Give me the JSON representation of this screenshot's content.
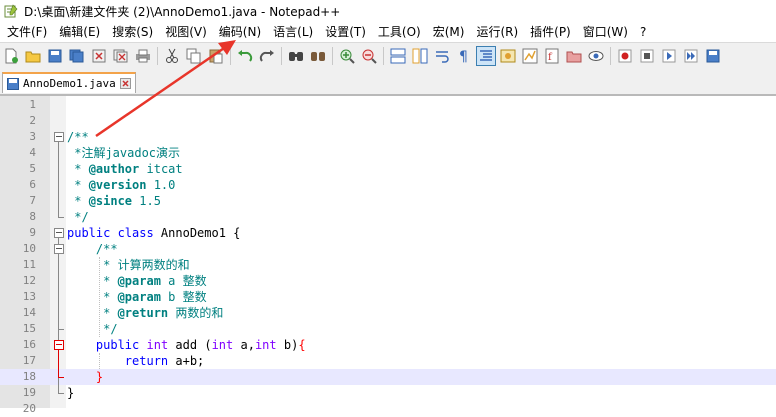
{
  "window": {
    "title": "D:\\桌面\\新建文件夹 (2)\\AnnoDemo1.java - Notepad++"
  },
  "menu": [
    "文件(F)",
    "编辑(E)",
    "搜索(S)",
    "视图(V)",
    "编码(N)",
    "语言(L)",
    "设置(T)",
    "工具(O)",
    "宏(M)",
    "运行(R)",
    "插件(P)",
    "窗口(W)",
    "?"
  ],
  "tab": {
    "label": "AnnoDemo1.java"
  },
  "editor": {
    "current_line": 18,
    "lines": [
      {
        "n": "1",
        "text": ""
      },
      {
        "n": "2",
        "text": ""
      },
      {
        "n": "3",
        "text": "/**"
      },
      {
        "n": "4",
        "text": " *注解javadoc演示"
      },
      {
        "n": "5",
        "at": "@author",
        "rest": " itcat"
      },
      {
        "n": "6",
        "at": "@version",
        "rest": " 1.0"
      },
      {
        "n": "7",
        "at": "@since",
        "rest": " 1.5"
      },
      {
        "n": "8",
        "text": " */"
      },
      {
        "n": "9",
        "kw": "public class",
        "rest": " AnnoDemo1 {"
      },
      {
        "n": "10",
        "text": "    /**"
      },
      {
        "n": "11",
        "text": "     * 计算两数的和"
      },
      {
        "n": "12",
        "at": "@param",
        "rest": " a 整数"
      },
      {
        "n": "13",
        "at": "@param",
        "rest": " b 整数"
      },
      {
        "n": "14",
        "at": "@return",
        "rest": " 两数的和"
      },
      {
        "n": "15",
        "text": "     */"
      },
      {
        "n": "16",
        "kw1": "public",
        "type1": "int",
        "name": "add",
        "type2": "int",
        "p1": "a,",
        "type3": "int",
        "p2": "b)",
        "brace": "{"
      },
      {
        "n": "17",
        "kw": "return",
        "rest": " a+b;"
      },
      {
        "n": "18",
        "brace": "}"
      },
      {
        "n": "19",
        "text": "}"
      },
      {
        "n": "20",
        "text": ""
      }
    ]
  }
}
